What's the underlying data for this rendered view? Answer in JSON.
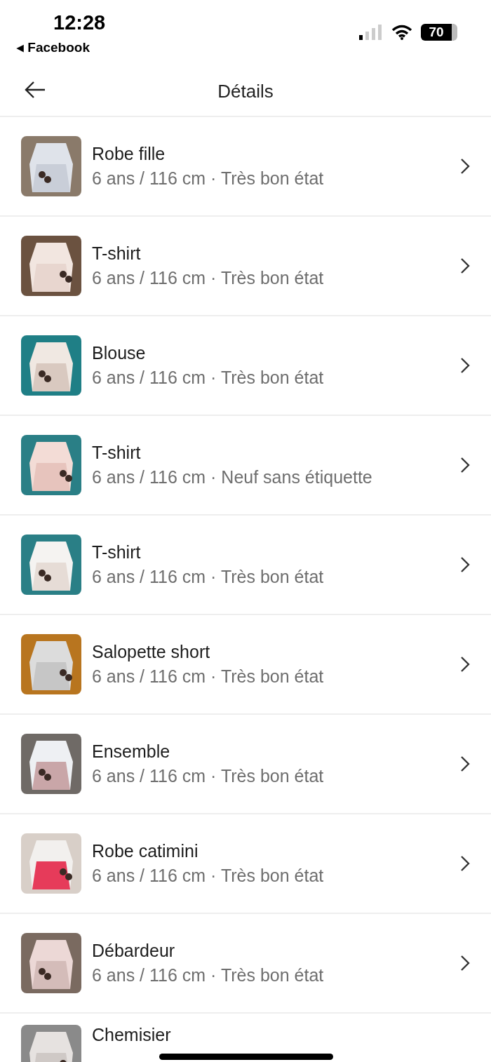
{
  "status_bar": {
    "time": "12:28",
    "back_arrow": "◂",
    "back_app": "Facebook",
    "battery": "70"
  },
  "header": {
    "title": "Détails"
  },
  "items": [
    {
      "title": "Robe fille",
      "subtitle": "6 ans / 116 cm · Très bon état"
    },
    {
      "title": "T-shirt",
      "subtitle": "6 ans / 116 cm · Très bon état"
    },
    {
      "title": "Blouse",
      "subtitle": "6 ans / 116 cm · Très bon état"
    },
    {
      "title": "T-shirt",
      "subtitle": "6 ans / 116 cm · Neuf sans étiquette"
    },
    {
      "title": "T-shirt",
      "subtitle": "6 ans / 116 cm · Très bon état"
    },
    {
      "title": "Salopette short",
      "subtitle": "6 ans / 116 cm · Très bon état"
    },
    {
      "title": "Ensemble",
      "subtitle": "6 ans / 116 cm · Très bon état"
    },
    {
      "title": "Robe catimini",
      "subtitle": "6 ans / 116 cm · Très bon état"
    },
    {
      "title": "Débardeur",
      "subtitle": "6 ans / 116 cm · Très bon état"
    },
    {
      "title": "Chemisier"
    }
  ]
}
